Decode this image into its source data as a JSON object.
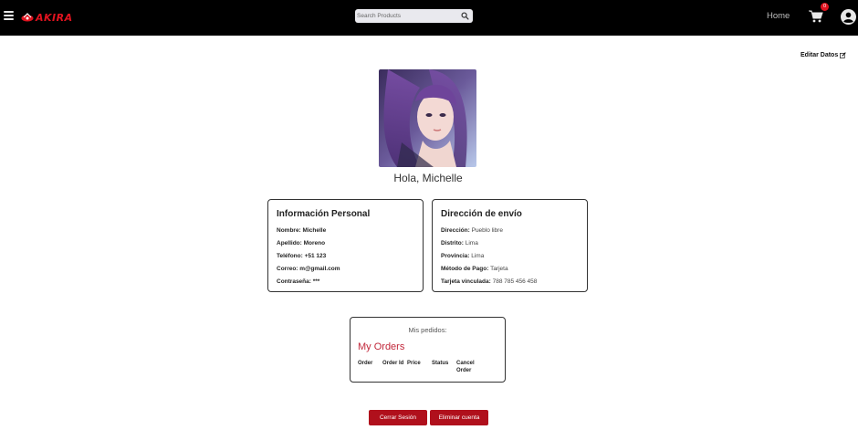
{
  "header": {
    "logo_text": "AKIRA",
    "search_placeholder": "Search Products",
    "nav_home": "Home",
    "cart_count": "0"
  },
  "profile": {
    "edit_label": "Editar Datos",
    "greeting": "Hola, Michelle"
  },
  "personal": {
    "title": "Información Personal",
    "fields": [
      {
        "label": "Nombre:",
        "value": "Michelle"
      },
      {
        "label": "Apellido:",
        "value": "Moreno"
      },
      {
        "label": "Teléfono:",
        "value": "+51 123"
      },
      {
        "label": "Correo:",
        "value": "m@gmail.com"
      },
      {
        "label": "Contraseña:",
        "value": "***"
      }
    ]
  },
  "shipping": {
    "title": "Dirección de envío",
    "fields": [
      {
        "label": "Dirección:",
        "value": "Pueblo libre"
      },
      {
        "label": "Distrito:",
        "value": "Lima"
      },
      {
        "label": "Provincia:",
        "value": "Lima"
      },
      {
        "label": "Método de Pago:",
        "value": "Tarjeta"
      },
      {
        "label": "Tarjeta vinculada:",
        "value": "788 785 456 458"
      }
    ]
  },
  "orders": {
    "subtitle": "Mis pedidos:",
    "title": "My Orders",
    "columns": [
      "Order",
      "Order Id",
      "Price",
      "Status",
      "Cancel Order"
    ]
  },
  "actions": {
    "logout_label": "Cerrar Sesión",
    "delete_label": "Eliminar cuenta"
  },
  "colors": {
    "accent": "#b0101c",
    "orders_title": "#c1273a",
    "navbar": "#000000"
  }
}
